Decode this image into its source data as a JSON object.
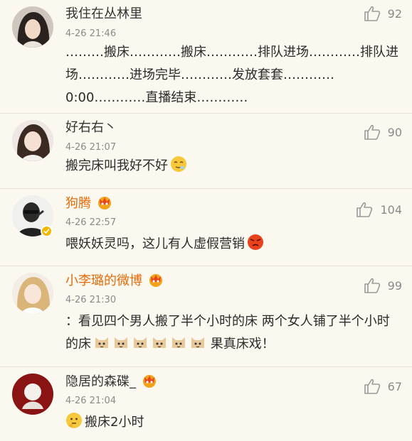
{
  "comments": [
    {
      "username": "我住在丛林里",
      "time": "4-26 21:46",
      "likes": "92",
      "text": "………搬床…………搬床…………排队进场…………排队进场…………进场完毕…………发放套套…………0:00…………直播结束…………"
    },
    {
      "username": "好右右丶",
      "time": "4-26 21:07",
      "likes": "90",
      "text": "搬完床叫我好不好"
    },
    {
      "username": "狗腾",
      "time": "4-26 22:57",
      "likes": "104",
      "text": "喂妖妖灵吗，这儿有人虚假营销"
    },
    {
      "username": "小李璐的微博",
      "time": "4-26 21:30",
      "likes": "99",
      "text": "：看见四个男人搬了半个小时的床 两个女人铺了半个小时的床",
      "text_after": " 果真床戏！"
    },
    {
      "username": "隐居的森碟_",
      "time": "4-26 21:04",
      "likes": "67",
      "text": "搬床2小时"
    }
  ],
  "colors": {
    "background": "#fbf8ef",
    "vip_name": "#e86b0a",
    "meta_text": "#8a8a8a"
  }
}
